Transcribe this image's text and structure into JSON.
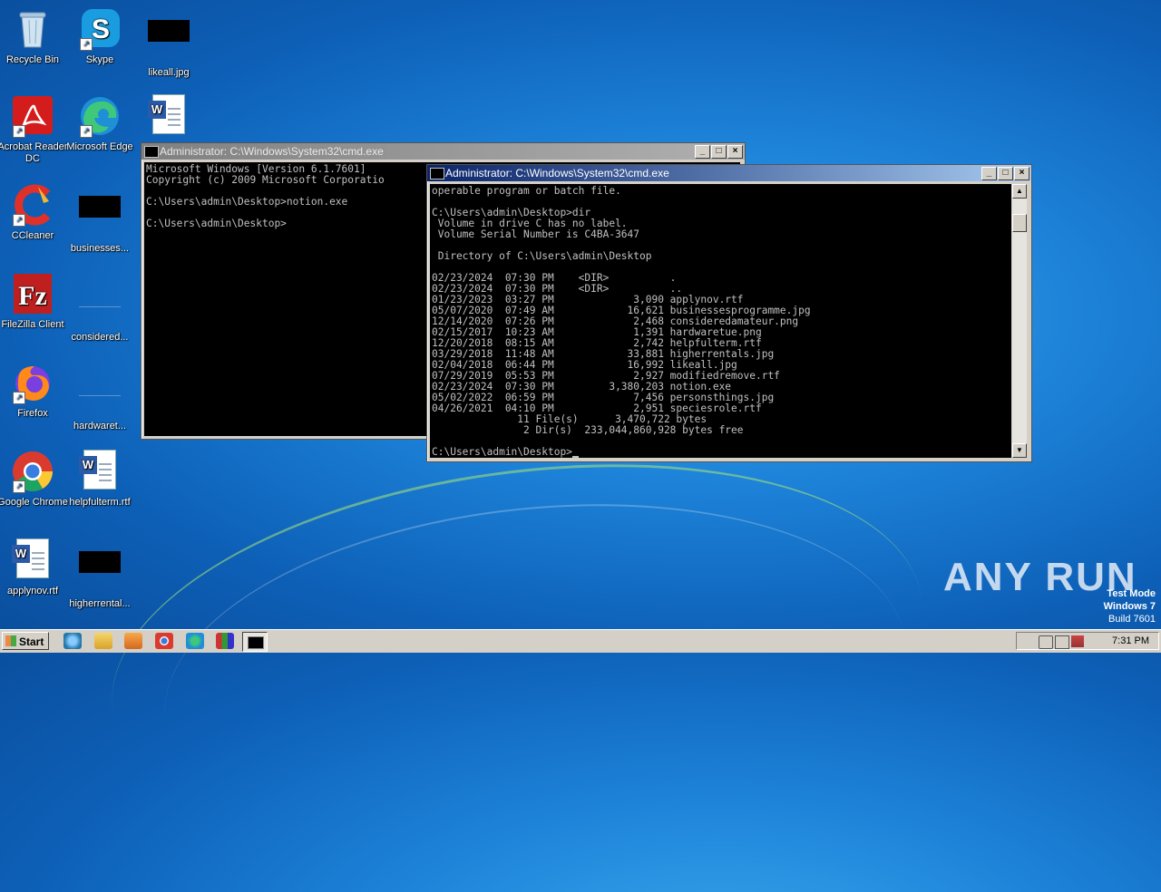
{
  "desktop": {
    "icons": [
      {
        "label": "Recycle Bin"
      },
      {
        "label": "Skype"
      },
      {
        "label": "likeall.jpg"
      },
      {
        "label": "Acrobat Reader DC"
      },
      {
        "label": "Microsoft Edge"
      },
      {
        "label": ""
      },
      {
        "label": "CCleaner"
      },
      {
        "label": "businesses..."
      },
      {
        "label": "FileZilla Client"
      },
      {
        "label": "considered..."
      },
      {
        "label": "Firefox"
      },
      {
        "label": "hardwaret..."
      },
      {
        "label": "Google Chrome"
      },
      {
        "label": "helpfulterm.rtf"
      },
      {
        "label": "applynov.rtf"
      },
      {
        "label": "higherrental..."
      }
    ]
  },
  "window_back": {
    "title": "Administrator: C:\\Windows\\System32\\cmd.exe",
    "lines": [
      "Microsoft Windows [Version 6.1.7601]",
      "Copyright (c) 2009 Microsoft Corporatio",
      "",
      "C:\\Users\\admin\\Desktop>notion.exe",
      "",
      "C:\\Users\\admin\\Desktop>"
    ]
  },
  "window_front": {
    "title": "Administrator: C:\\Windows\\System32\\cmd.exe",
    "lines": [
      "operable program or batch file.",
      "",
      "C:\\Users\\admin\\Desktop>dir",
      " Volume in drive C has no label.",
      " Volume Serial Number is C4BA-3647",
      "",
      " Directory of C:\\Users\\admin\\Desktop",
      "",
      "02/23/2024  07:30 PM    <DIR>          .",
      "02/23/2024  07:30 PM    <DIR>          ..",
      "01/23/2023  03:27 PM             3,090 applynov.rtf",
      "05/07/2020  07:49 AM            16,621 businessesprogramme.jpg",
      "12/14/2020  07:26 PM             2,468 consideredamateur.png",
      "02/15/2017  10:23 AM             1,391 hardwaretue.png",
      "12/20/2018  08:15 AM             2,742 helpfulterm.rtf",
      "03/29/2018  11:48 AM            33,881 higherrentals.jpg",
      "02/04/2018  06:44 PM            16,992 likeall.jpg",
      "07/29/2019  05:53 PM             2,927 modifiedremove.rtf",
      "02/23/2024  07:30 PM         3,380,203 notion.exe",
      "05/02/2022  06:59 PM             7,456 personsthings.jpg",
      "04/26/2021  04:10 PM             2,951 speciesrole.rtf",
      "              11 File(s)      3,470,722 bytes",
      "               2 Dir(s)  233,044,860,928 bytes free",
      "",
      "C:\\Users\\admin\\Desktop>"
    ]
  },
  "watermark": {
    "text": "ANY RUN"
  },
  "testmode": {
    "line1": "Test Mode",
    "line2": "Windows 7",
    "line3": "Build 7601"
  },
  "taskbar": {
    "start_label": "Start",
    "clock": "7:31 PM"
  }
}
